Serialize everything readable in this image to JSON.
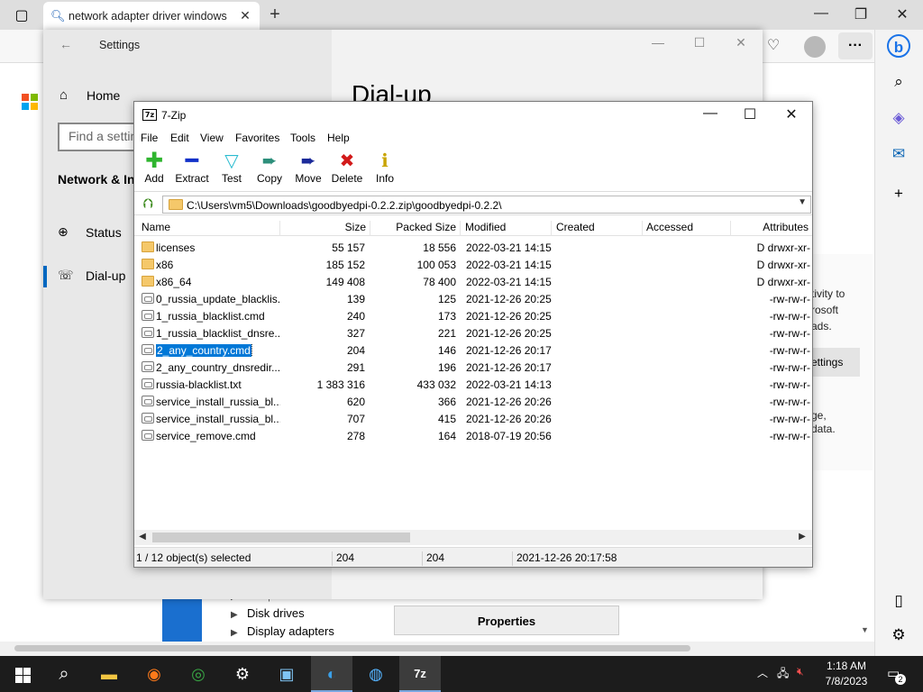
{
  "browser": {
    "tab_title": "network adapter driver windows",
    "new_tab": "+",
    "ctrl_min": "—",
    "ctrl_max": "❐",
    "ctrl_close": "✕"
  },
  "settings": {
    "title": "Settings",
    "home": "Home",
    "search_placeholder": "Find a setting",
    "section": "Network & Internet",
    "nav_status": "Status",
    "nav_dialup": "Dial-up",
    "heading": "Dial-up",
    "card_lines": [
      "tivity to",
      "rosoft",
      "ads."
    ],
    "card_button": "ettings",
    "card_lines2": [
      "ge,",
      "data."
    ]
  },
  "devmgr": {
    "row_computer": "Computer",
    "row_disk": "Disk drives",
    "row_display": "Display adapters",
    "properties": "Properties"
  },
  "zip": {
    "title": "7-Zip",
    "menu": [
      "File",
      "Edit",
      "View",
      "Favorites",
      "Tools",
      "Help"
    ],
    "tools": [
      {
        "label": "Add",
        "icon": "add-icon"
      },
      {
        "label": "Extract",
        "icon": "extract-icon"
      },
      {
        "label": "Test",
        "icon": "test-icon"
      },
      {
        "label": "Copy",
        "icon": "copy-icon"
      },
      {
        "label": "Move",
        "icon": "move-icon"
      },
      {
        "label": "Delete",
        "icon": "delete-icon"
      },
      {
        "label": "Info",
        "icon": "info-icon"
      }
    ],
    "path": "C:\\Users\\vm5\\Downloads\\goodbyedpi-0.2.2.zip\\goodbyedpi-0.2.2\\",
    "columns": [
      "Name",
      "Size",
      "Packed Size",
      "Modified",
      "Created",
      "Accessed",
      "Attributes"
    ],
    "rows": [
      {
        "type": "folder",
        "name": "licenses",
        "size": "55 157",
        "packed": "18 556",
        "modified": "2022-03-21 14:15",
        "attr": "D drwxr-xr-"
      },
      {
        "type": "folder",
        "name": "x86",
        "size": "185 152",
        "packed": "100 053",
        "modified": "2022-03-21 14:15",
        "attr": "D drwxr-xr-"
      },
      {
        "type": "folder",
        "name": "x86_64",
        "size": "149 408",
        "packed": "78 400",
        "modified": "2022-03-21 14:15",
        "attr": "D drwxr-xr-"
      },
      {
        "type": "file",
        "name": "0_russia_update_blacklis...",
        "size": "139",
        "packed": "125",
        "modified": "2021-12-26 20:25",
        "attr": "-rw-rw-r-"
      },
      {
        "type": "file",
        "name": "1_russia_blacklist.cmd",
        "size": "240",
        "packed": "173",
        "modified": "2021-12-26 20:25",
        "attr": "-rw-rw-r-"
      },
      {
        "type": "file",
        "name": "1_russia_blacklist_dnsre...",
        "size": "327",
        "packed": "221",
        "modified": "2021-12-26 20:25",
        "attr": "-rw-rw-r-"
      },
      {
        "type": "file",
        "name": "2_any_country.cmd",
        "size": "204",
        "packed": "146",
        "modified": "2021-12-26 20:17",
        "attr": "-rw-rw-r-",
        "selected": true
      },
      {
        "type": "file",
        "name": "2_any_country_dnsredir...",
        "size": "291",
        "packed": "196",
        "modified": "2021-12-26 20:17",
        "attr": "-rw-rw-r-"
      },
      {
        "type": "file",
        "name": "russia-blacklist.txt",
        "size": "1 383 316",
        "packed": "433 032",
        "modified": "2022-03-21 14:13",
        "attr": "-rw-rw-r-"
      },
      {
        "type": "file",
        "name": "service_install_russia_bl...",
        "size": "620",
        "packed": "366",
        "modified": "2021-12-26 20:26",
        "attr": "-rw-rw-r-"
      },
      {
        "type": "file",
        "name": "service_install_russia_bl...",
        "size": "707",
        "packed": "415",
        "modified": "2021-12-26 20:26",
        "attr": "-rw-rw-r-"
      },
      {
        "type": "file",
        "name": "service_remove.cmd",
        "size": "278",
        "packed": "164",
        "modified": "2018-07-19 20:56",
        "attr": "-rw-rw-r-"
      }
    ],
    "status": {
      "selection": "1 / 12 object(s) selected",
      "size": "204",
      "packed": "204",
      "modified": "2021-12-26 20:17:58"
    }
  },
  "taskbar": {
    "time": "1:18 AM",
    "date": "7/8/2023",
    "notifications": "2"
  },
  "colors": {
    "selection": "#0078d7",
    "taskbar": "#1c1c1c",
    "accent": "#0067c0"
  }
}
